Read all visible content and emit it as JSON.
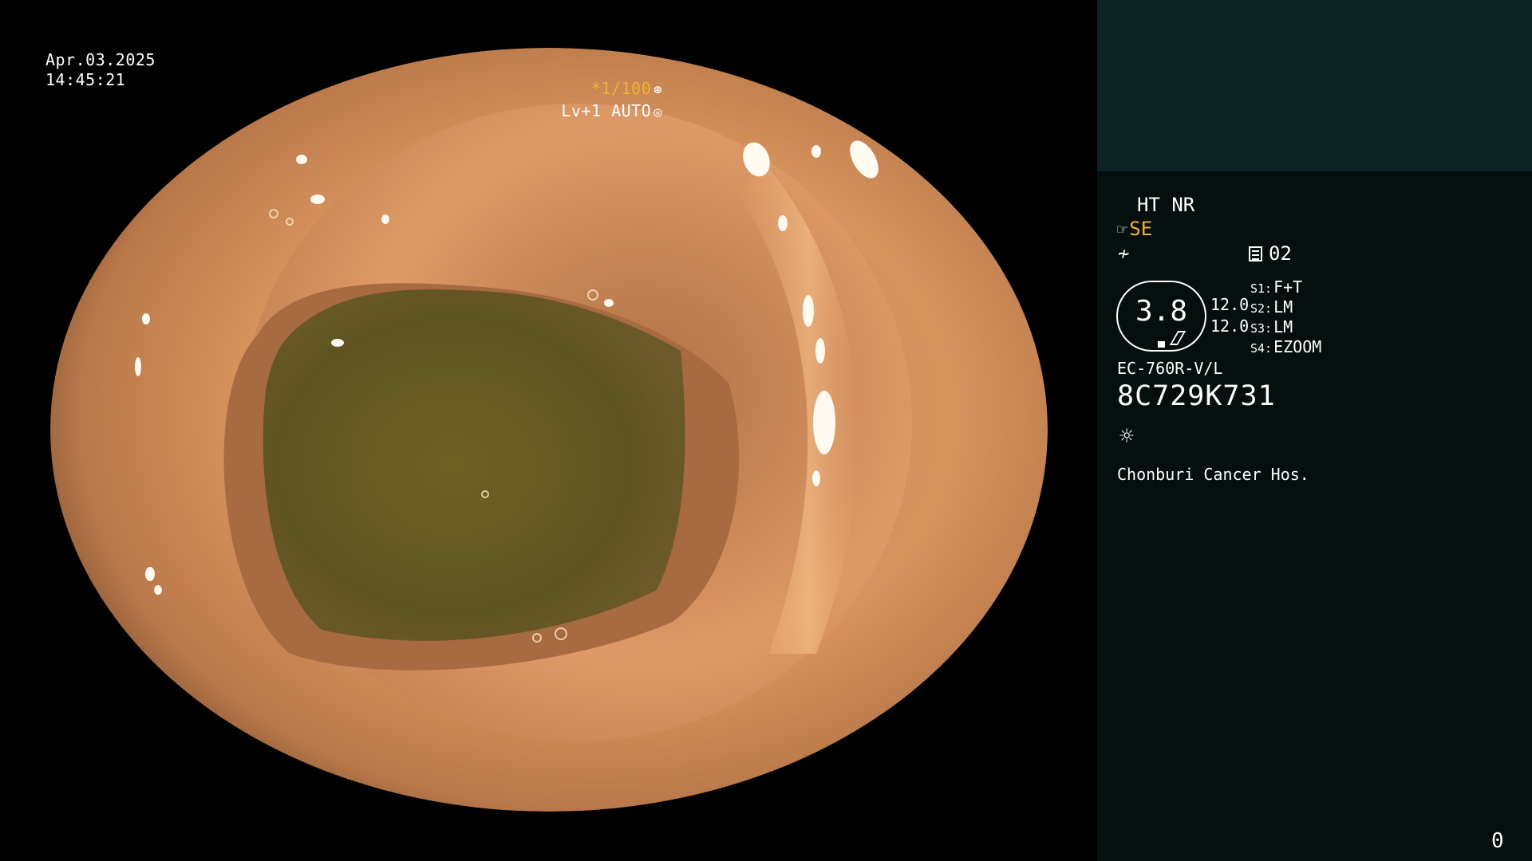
{
  "scope": {
    "date": "Apr.03.2025",
    "time": "14:45:21",
    "shutter": "*1/100",
    "shutter_icon": "aperture-icon",
    "level": "Lv+1 AUTO",
    "level_icon": "auto-iris-icon"
  },
  "panel": {
    "image_mode": "HT NR",
    "enhancement": "SE",
    "enhancement_icon": "structure-enhance-icon",
    "freeze_icon": "freeze-icon",
    "record": "02",
    "record_icon": "record-icon",
    "gauge_value": "3.8",
    "ratio_1": "12.0",
    "ratio_2": "12.0",
    "switches": [
      {
        "key": "S1:",
        "value": "F+T"
      },
      {
        "key": "S2:",
        "value": "LM"
      },
      {
        "key": "S3:",
        "value": "LM"
      },
      {
        "key": "S4:",
        "value": "EZOOM"
      }
    ],
    "model": "EC-760R-V/L",
    "serial": "8C729K731",
    "light_icon": "light-source-icon",
    "hospital": "Chonburi Cancer Hos.",
    "frame_counter": "0"
  },
  "colors": {
    "accent": "#f2b12e",
    "panel_bg": "#050f0e",
    "panel_top_bg": "#0d2222"
  }
}
